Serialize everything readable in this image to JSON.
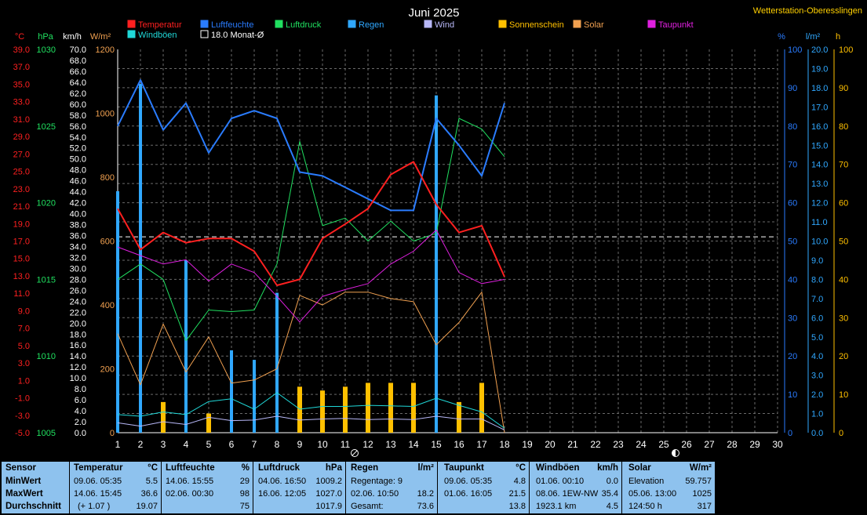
{
  "header": {
    "title": "Juni 2025",
    "station": "Wetterstation-Oberesslingen"
  },
  "legend": [
    {
      "label": "Temperatur",
      "color": "#ff2020"
    },
    {
      "label": "Luftfeuchte",
      "color": "#2a7cff"
    },
    {
      "label": "Luftdruck",
      "color": "#20e060"
    },
    {
      "label": "Regen",
      "color": "#30a8ff"
    },
    {
      "label": "Wind",
      "color": "#b8b8f8"
    },
    {
      "label": "Sonnenschein",
      "color": "#ffc000"
    },
    {
      "label": "Solar",
      "color": "#f0a050"
    },
    {
      "label": "Taupunkt",
      "color": "#e020e0"
    },
    {
      "label": "Windböen",
      "color": "#20d8d8"
    },
    {
      "label": "18.0 Monat-Ø",
      "color": "#ffffff"
    }
  ],
  "units": {
    "temp": "°C",
    "pressure": "hPa",
    "wind": "km/h",
    "solar": "W/m²",
    "humidity": "%",
    "rain": "l/m²",
    "sun": "h"
  },
  "chart_data": {
    "type": "line",
    "title": "Juni 2025",
    "x": [
      1,
      2,
      3,
      4,
      5,
      6,
      7,
      8,
      9,
      10,
      11,
      12,
      13,
      14,
      15,
      16,
      17,
      18
    ],
    "xlim": [
      1,
      30
    ],
    "x_ticks": [
      "1",
      "2",
      "3",
      "4",
      "5",
      "6",
      "7",
      "8",
      "9",
      "10",
      "11",
      "12",
      "13",
      "14",
      "15",
      "16",
      "17",
      "18",
      "19",
      "20",
      "21",
      "22",
      "23",
      "24",
      "25",
      "26",
      "27",
      "28",
      "29",
      "30"
    ],
    "axes": {
      "temp": {
        "label": "°C",
        "range": [
          -5,
          40
        ],
        "ticks": [
          "-5.0",
          "-3.0",
          "-1.0",
          "1.0",
          "3.0",
          "5.0",
          "7.0",
          "9.0",
          "11.0",
          "13.0",
          "15.0",
          "17.0",
          "19.0",
          "21.0",
          "23.0",
          "25.0",
          "27.0",
          "29.0",
          "31.0",
          "33.0",
          "35.0",
          "37.0",
          "39.0"
        ]
      },
      "pressure": {
        "label": "hPa",
        "range": [
          1005,
          1030
        ],
        "ticks": [
          "1005",
          "1010",
          "1015",
          "1020",
          "1025",
          "1030"
        ]
      },
      "wind": {
        "label": "km/h",
        "range": [
          0,
          70
        ],
        "ticks": [
          "0.0",
          "2.0",
          "4.0",
          "6.0",
          "8.0",
          "10.0",
          "12.0",
          "14.0",
          "16.0",
          "18.0",
          "20.0",
          "22.0",
          "24.0",
          "26.0",
          "28.0",
          "30.0",
          "32.0",
          "34.0",
          "36.0",
          "38.0",
          "40.0",
          "42.0",
          "44.0",
          "46.0",
          "48.0",
          "50.0",
          "52.0",
          "54.0",
          "56.0",
          "58.0",
          "60.0",
          "62.0",
          "64.0",
          "66.0",
          "68.0",
          "70.0"
        ]
      },
      "solar": {
        "label": "W/m²",
        "range": [
          0,
          1200
        ],
        "ticks": [
          "0",
          "200",
          "400",
          "600",
          "800",
          "1000",
          "1200"
        ]
      },
      "humidity": {
        "label": "%",
        "range": [
          0,
          100
        ],
        "ticks": [
          "0",
          "10",
          "20",
          "30",
          "40",
          "50",
          "60",
          "70",
          "80",
          "90",
          "100"
        ]
      },
      "rain": {
        "label": "l/m²",
        "range": [
          0,
          20
        ],
        "ticks": [
          "0.0",
          "1.0",
          "2.0",
          "3.0",
          "4.0",
          "5.0",
          "6.0",
          "7.0",
          "8.0",
          "9.0",
          "10.0",
          "11.0",
          "12.0",
          "13.0",
          "14.0",
          "15.0",
          "16.0",
          "17.0",
          "18.0",
          "19.0",
          "20.0"
        ]
      },
      "sun": {
        "label": "h",
        "range": [
          0,
          100
        ],
        "ticks": [
          "0",
          "10",
          "20",
          "30",
          "40",
          "50",
          "60",
          "70",
          "80",
          "90",
          "100"
        ]
      }
    },
    "monthly_avg_temp": 18.0,
    "series": [
      {
        "name": "Temperatur",
        "axis": "temp",
        "color": "#ff2020",
        "width": 2,
        "values": [
          21.3,
          16.5,
          18.5,
          17.3,
          17.8,
          17.8,
          16.3,
          12.3,
          13.0,
          17.8,
          19.5,
          21.3,
          25.3,
          26.8,
          21.8,
          18.5,
          19.3,
          13.3
        ]
      },
      {
        "name": "Luftfeuchte",
        "axis": "humidity",
        "color": "#2a7cff",
        "width": 2,
        "values": [
          80,
          92,
          79,
          86,
          73,
          82,
          84,
          82,
          68,
          67,
          64,
          61,
          58,
          58,
          82,
          75,
          67,
          86
        ]
      },
      {
        "name": "Luftdruck",
        "axis": "pressure",
        "color": "#20e060",
        "width": 1,
        "values": [
          1015,
          1016,
          1015,
          1011,
          1013,
          1012.9,
          1013,
          1016,
          1024,
          1018.5,
          1019,
          1017.5,
          1018.8,
          1017.5,
          1018,
          1025.5,
          1024.8,
          1023
        ]
      },
      {
        "name": "Solar",
        "axis": "solar",
        "color": "#f0a050",
        "width": 1,
        "values": [
          310,
          150,
          340,
          190,
          300,
          155,
          165,
          200,
          430,
          400,
          440,
          440,
          420,
          410,
          275,
          345,
          440,
          0
        ]
      },
      {
        "name": "Taupunkt",
        "axis": "temp",
        "color": "#e020e0",
        "width": 1,
        "values": [
          16.8,
          15.8,
          14.8,
          15.3,
          12.8,
          14.8,
          13.8,
          11.0,
          8.0,
          11.0,
          11.8,
          12.5,
          14.8,
          16.3,
          18.8,
          13.8,
          12.5,
          13.0
        ]
      },
      {
        "name": "Wind",
        "axis": "wind",
        "color": "#b8b8f8",
        "width": 1,
        "values": [
          1.8,
          1.2,
          2.0,
          1.5,
          2.8,
          2.2,
          2.3,
          3.0,
          2.3,
          2.5,
          2.6,
          2.4,
          2.5,
          2.4,
          3.0,
          2.5,
          2.5,
          0.5
        ]
      },
      {
        "name": "Windböen",
        "axis": "wind",
        "color": "#20d8d8",
        "width": 1,
        "values": [
          3.3,
          3.0,
          3.8,
          3.3,
          5.7,
          6.2,
          4.3,
          7.3,
          4.3,
          4.8,
          4.8,
          5.0,
          4.9,
          4.8,
          6.3,
          5.0,
          3.8,
          0.8
        ]
      }
    ],
    "bars": [
      {
        "name": "Regen",
        "axis": "rain",
        "color": "#30a8ff",
        "width": 4,
        "values": [
          12.6,
          18.2,
          0,
          9.0,
          0,
          4.3,
          3.8,
          7.3,
          0,
          0,
          0,
          0,
          0,
          0,
          17.6,
          0,
          0,
          0
        ]
      },
      {
        "name": "Sonnenschein",
        "axis": "sun",
        "color": "#ffc000",
        "width": 6,
        "values": [
          0,
          0,
          8,
          0,
          5,
          0,
          0,
          0,
          12,
          11,
          12,
          13,
          13,
          13,
          0,
          8,
          13,
          0
        ]
      }
    ]
  },
  "stats": {
    "headers": {
      "sensor": "Sensor",
      "temp": "Temperatur",
      "temp_u": "°C",
      "hum": "Luftfeuchte",
      "hum_u": "%",
      "press": "Luftdruck",
      "press_u": "hPa",
      "rain": "Regen",
      "rain_u": "l/m²",
      "dew": "Taupunkt",
      "dew_u": "°C",
      "gust": "Windböen",
      "gust_u": "km/h",
      "solar": "Solar",
      "solar_u": "W/m²"
    },
    "rowlabels": [
      "MinWert",
      "MaxWert",
      "Durchschnitt"
    ],
    "temp": [
      [
        "09.06. 05:35",
        "5.5"
      ],
      [
        "14.06. 15:45",
        "36.6"
      ],
      [
        "(+ 1.07 )",
        "19.07"
      ]
    ],
    "hum": [
      [
        "14.06. 15:55",
        "29"
      ],
      [
        "02.06. 00:30",
        "98"
      ],
      [
        "",
        "75"
      ]
    ],
    "press": [
      [
        "04.06. 16:50",
        "1009.2"
      ],
      [
        "16.06. 12:05",
        "1027.0"
      ],
      [
        "",
        "1017.9"
      ]
    ],
    "rain": [
      [
        "Regentage: 9",
        ""
      ],
      [
        "02.06. 10:50",
        "18.2"
      ],
      [
        "Gesamt:",
        "73.6"
      ]
    ],
    "dew": [
      [
        "09.06. 05:35",
        "4.8"
      ],
      [
        "01.06. 16:05",
        "21.5"
      ],
      [
        "",
        "13.8"
      ]
    ],
    "gust": [
      [
        "01.06. 00:10",
        "0.0"
      ],
      [
        "08.06. 1EW-NW",
        "35.4"
      ],
      [
        "1923.1 km",
        "4.5"
      ]
    ],
    "solar": [
      [
        "Elevation",
        "59.757"
      ],
      [
        "05.06. 13:00",
        "1025"
      ],
      [
        "124:50 h",
        "317"
      ]
    ]
  }
}
